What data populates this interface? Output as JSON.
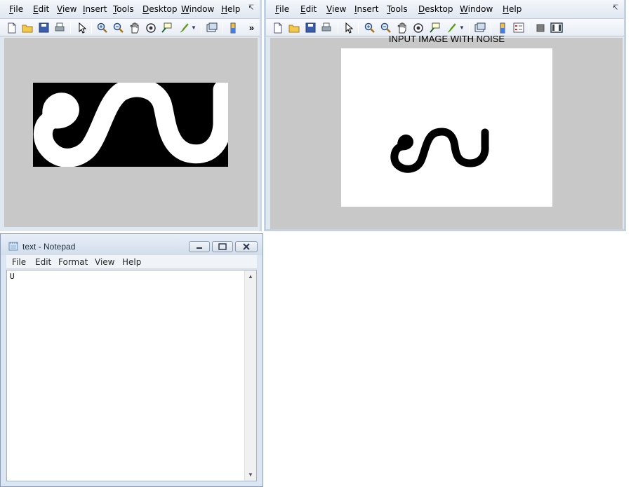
{
  "matlab_menu": [
    "File",
    "Edit",
    "View",
    "Insert",
    "Tools",
    "Desktop",
    "Window",
    "Help"
  ],
  "right_figure": {
    "axes_title": "INPUT IMAGE WITH NOISE"
  },
  "notepad": {
    "title": "text - Notepad",
    "menu": [
      "File",
      "Edit",
      "Format",
      "View",
      "Help"
    ],
    "content": "U"
  },
  "colors": {
    "canvas_gray": "#c8c8c8",
    "title_gradient": "#d3deec"
  },
  "icons": {
    "toolbar": [
      "new-file-icon",
      "open-folder-icon",
      "save-icon",
      "print-icon",
      "pointer-icon",
      "zoom-in-icon",
      "zoom-out-icon",
      "pan-hand-icon",
      "rotate-3d-icon",
      "data-cursor-icon",
      "brush-icon",
      "link-plot-icon",
      "colorbar-icon",
      "legend-icon",
      "hide-plot-tools-icon",
      "show-plot-tools-icon"
    ]
  }
}
